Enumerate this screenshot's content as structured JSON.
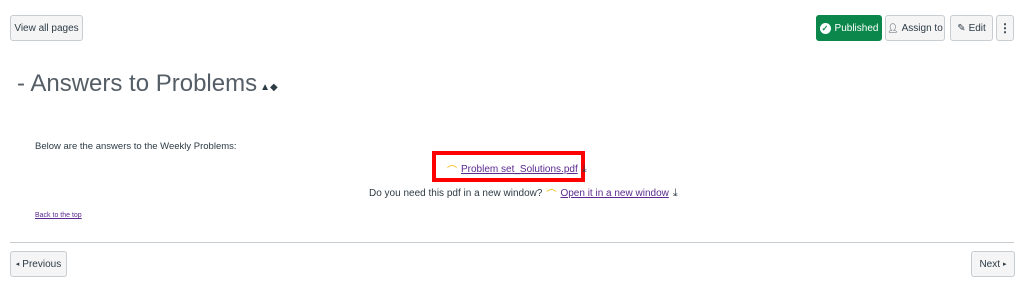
{
  "header": {
    "view_all_label": "View all pages",
    "published_label": "Published",
    "assign_label": "Assign to",
    "edit_label": "Edit",
    "more_label": "⋮"
  },
  "page": {
    "title": "- Answers to Problems",
    "intro": "Below are the answers to the Weekly Problems:",
    "file_link": "Problem set_Solutions.pdf",
    "new_window_question": "Do you need this pdf in a new window?",
    "new_window_link": "Open it in a new window",
    "back_to_top": "Back to the top"
  },
  "footer": {
    "previous_label": "Previous",
    "next_label": "Next"
  },
  "icons": {
    "check": "check-icon",
    "person": "person-icon",
    "pencil": "pencil-icon",
    "download": "download-icon",
    "preview": "preview-icon"
  },
  "colors": {
    "published_bg": "#0b874b",
    "link": "#5b2a8e",
    "highlight_box": "#ff0000"
  }
}
